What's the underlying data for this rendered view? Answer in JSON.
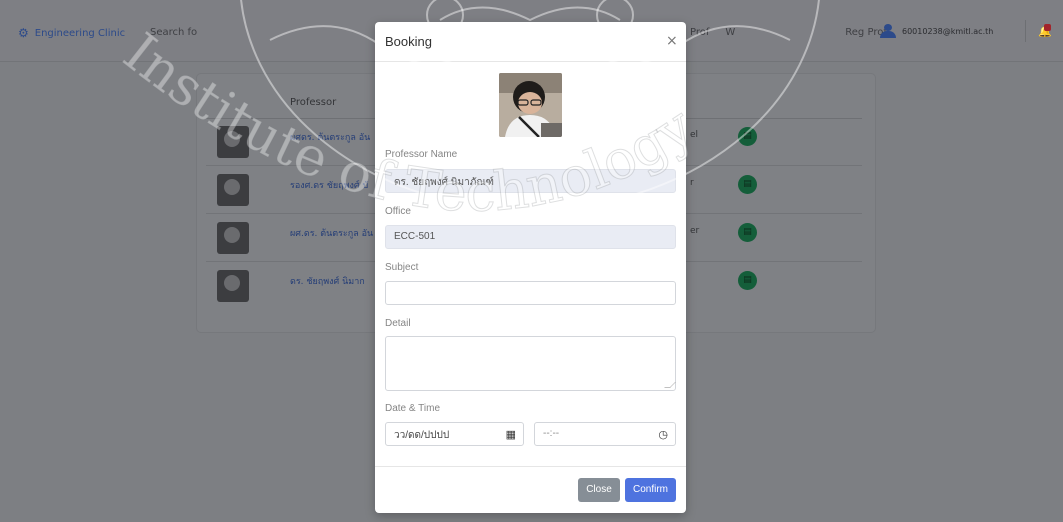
{
  "navbar": {
    "brand": "Engineering Clinic",
    "search": "Search fo",
    "links": [
      "Prof",
      "W",
      "Reg Prof"
    ],
    "user_email": "60010238@kmitl.ac.th"
  },
  "background_table": {
    "column_header": "Professor",
    "rows": [
      {
        "name": "ผศดร. ต้นตระกูล อัน",
        "extra": "el"
      },
      {
        "name": "รองศ.ดร ชัยฤพงศ์ บั",
        "extra": "r"
      },
      {
        "name": "ผศ.ดร. ต้นตระกูล อัน",
        "extra": "er"
      },
      {
        "name": "ดร. ชัยฤพงศ์ นิมาก",
        "extra": ""
      }
    ]
  },
  "modal": {
    "title": "Booking",
    "close_icon": "×",
    "professor_label": "Professor Name",
    "professor_value": "ดร. ชัยฤพงศ์  นิมาภัณฑ์",
    "office_label": "Office",
    "office_value": "ECC-501",
    "subject_label": "Subject",
    "subject_value": "",
    "detail_label": "Detail",
    "datetime_label": "Date & Time",
    "date_placeholder": "วว/ดด/ปปปป",
    "time_placeholder": "--:--",
    "close_button": "Close",
    "confirm_button": "Confirm"
  },
  "watermark": {
    "text": "Institute of Technology"
  },
  "colors": {
    "primary": "#4e73df",
    "secondary": "#868e96",
    "success": "#1cc88a",
    "overlay": "#7d7f83"
  }
}
